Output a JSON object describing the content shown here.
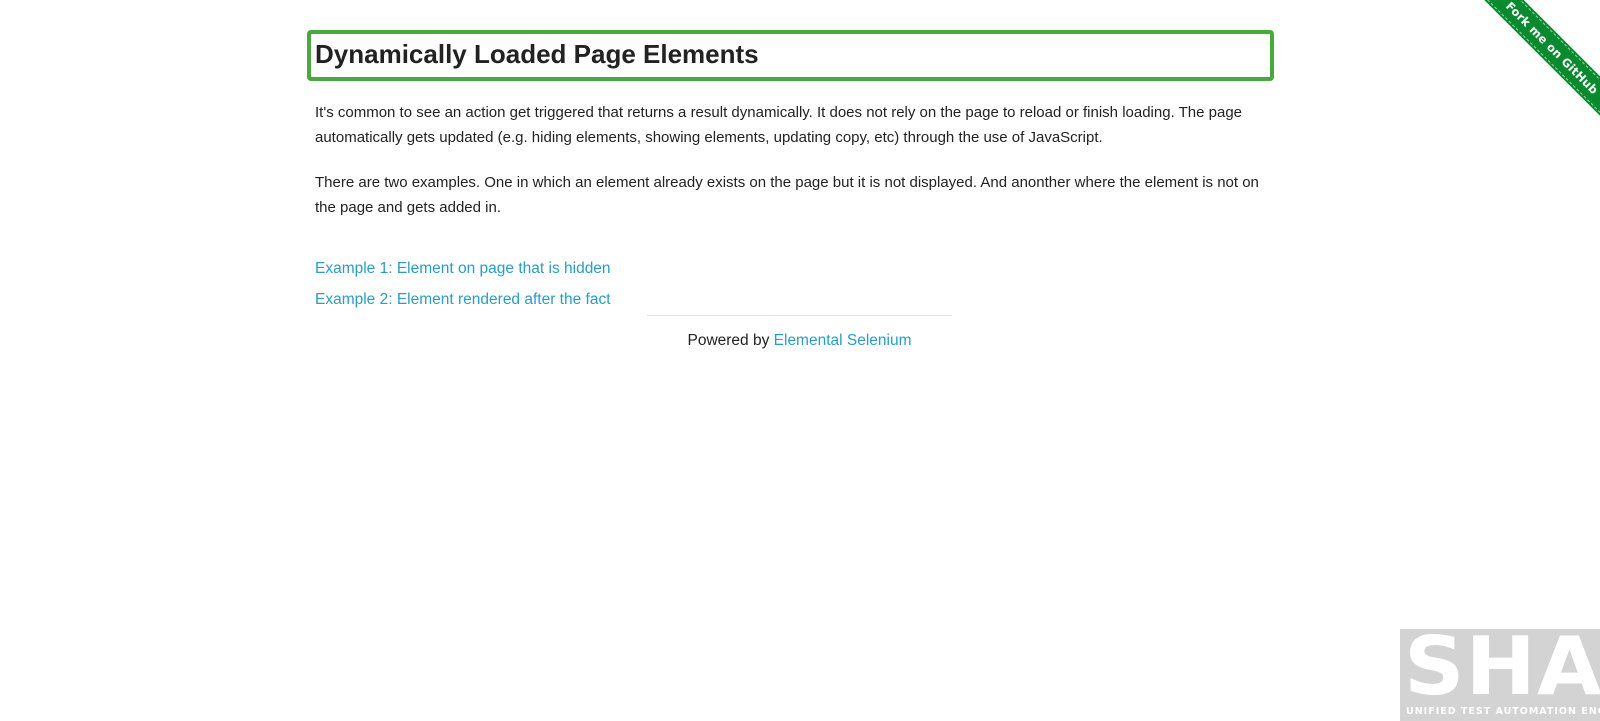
{
  "main": {
    "title": "Dynamically Loaded Page Elements",
    "paragraph_1": "It's common to see an action get triggered that returns a result dynamically. It does not rely on the page to reload or finish loading. The page automatically gets updated (e.g. hiding elements, showing elements, updating copy, etc) through the use of JavaScript.",
    "paragraph_2": "There are two examples. One in which an element already exists on the page but it is not displayed. And anonther where the element is not on the page and gets added in.",
    "links": [
      {
        "label": "Example 1: Element on page that is hidden"
      },
      {
        "label": "Example 2: Element rendered after the fact"
      }
    ]
  },
  "footer": {
    "prefix": "Powered by",
    "link_label": "Elemental Selenium"
  },
  "ribbon": {
    "label": "Fork me on GitHub",
    "color": "#0a8a2e"
  },
  "watermark": {
    "word": "SHAFT",
    "tagline": "UNIFIED TEST AUTOMATION ENGINE"
  },
  "colors": {
    "highlight_border": "#47ab3c",
    "link": "#2b9dc2",
    "text": "#222222"
  }
}
